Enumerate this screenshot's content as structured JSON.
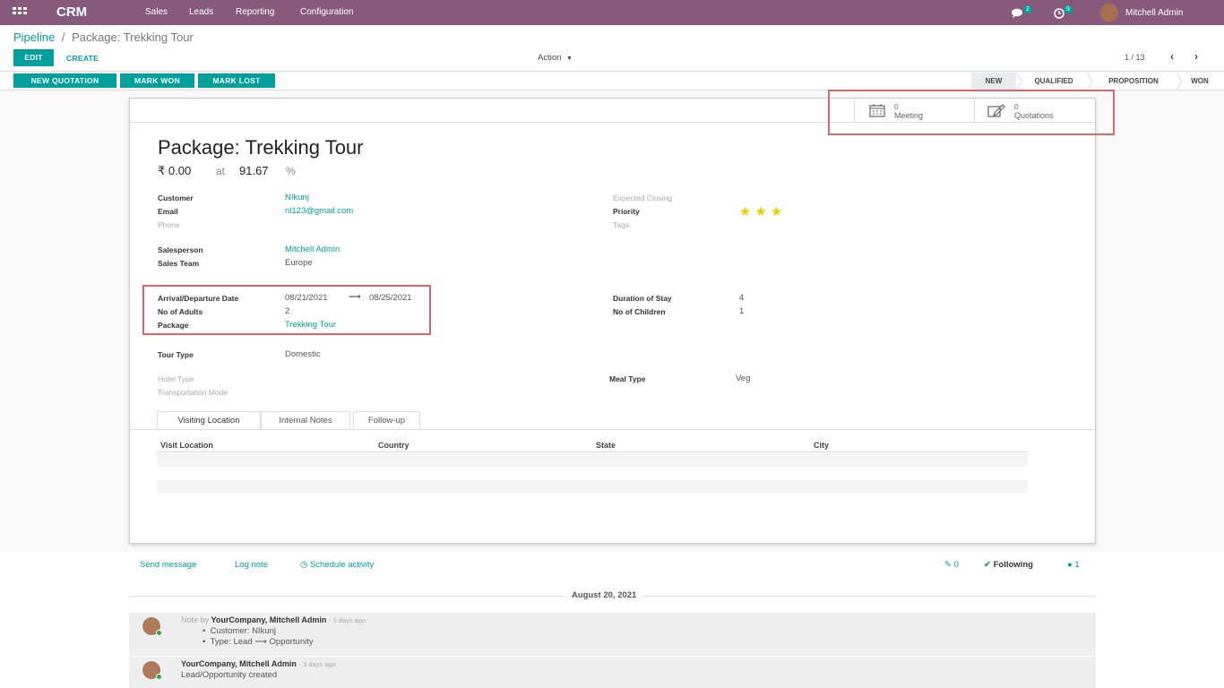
{
  "nav": {
    "brand": "CRM",
    "menus": [
      "Sales",
      "Leads",
      "Reporting",
      "Configuration"
    ],
    "messages_count": "2",
    "activities_count": "9",
    "user": "Mitchell Admin"
  },
  "breadcrumb": {
    "parent": "Pipeline",
    "sep": "/",
    "current": "Package: Trekking Tour"
  },
  "buttons": {
    "edit": "EDIT",
    "create": "CREATE",
    "action": "Action",
    "pager": "1 / 13"
  },
  "header_buttons": {
    "new_quotation": "NEW QUOTATION",
    "mark_won": "MARK WON",
    "mark_lost": "MARK LOST"
  },
  "stages": {
    "new": "NEW",
    "qualified": "QUALIFIED",
    "proposition": "PROPOSITION",
    "won": "WON"
  },
  "smart_buttons": {
    "meeting_count": "0",
    "meeting_label": "Meeting",
    "quotations_count": "0",
    "quotations_label": "Quotations"
  },
  "form": {
    "title": "Package: Trekking Tour",
    "revenue": "₹ 0.00",
    "at": "at",
    "probability": "91.67",
    "percent": "%",
    "customer_label": "Customer",
    "customer": "NIkunj",
    "email_label": "Email",
    "email": "nl123@gmail.com",
    "phone_label": "Phone",
    "expected_closing_label": "Expected Closing",
    "priority_label": "Priority",
    "priority_stars": 3,
    "tags_label": "Tags",
    "salesperson_label": "Salesperson",
    "salesperson": "Mitchell Admin",
    "sales_team_label": "Sales Team",
    "sales_team": "Europe",
    "arrival_label": "Arrival/Departure Date",
    "arrival": "08/21/2021",
    "arrow": "⟶",
    "departure": "08/25/2021",
    "adults_label": "No of Adults",
    "adults": "2",
    "package_label": "Package",
    "package": "Trekking Tour",
    "duration_label": "Duration of Stay",
    "duration": "4",
    "children_label": "No of Children",
    "children": "1",
    "tour_type_label": "Tour Type",
    "tour_type": "Domestic",
    "hotel_type_label": "Hotel Type",
    "transport_label": "Transportation Mode",
    "meal_type_label": "Meal Type",
    "meal_type": "Veg"
  },
  "tabs": [
    "Visiting Location",
    "Internal Notes",
    "Follow-up"
  ],
  "table_headers": [
    "Visit Location",
    "Country",
    "State",
    "City"
  ],
  "chatter": {
    "send_message": "Send message",
    "log_note": "Log note",
    "schedule_activity": "Schedule activity",
    "attachments": "0",
    "following": "Following",
    "followers": "1",
    "date_sep": "August 20, 2021",
    "msg1": {
      "prefix": "Note by",
      "author": "YourCompany, Mitchell Admin",
      "time": "- 3 days ago",
      "line1": "Customer: NIkunj",
      "line2": "Type: Lead ⟶ Opportunity"
    },
    "msg2": {
      "author": "YourCompany, Mitchell Admin",
      "time": "- 3 days ago",
      "body": "Lead/Opportunity created"
    }
  },
  "colors": {
    "brand": "#875a7b",
    "accent": "#00a09d",
    "highlight": "#d9666f",
    "star": "#f3cc00"
  }
}
